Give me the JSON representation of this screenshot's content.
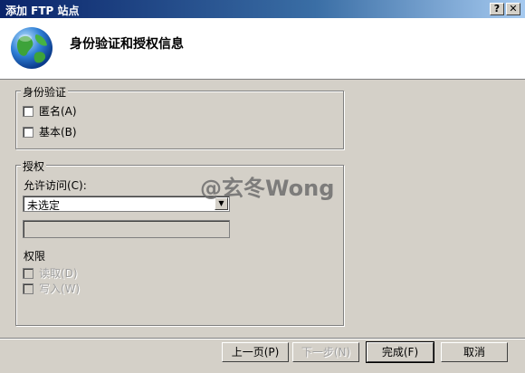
{
  "window": {
    "title": "添加 FTP 站点",
    "help_label": "?",
    "close_label": "✕"
  },
  "header": {
    "title": "身份验证和授权信息",
    "icon": "globe-icon"
  },
  "authentication": {
    "legend": "身份验证",
    "anonymous_label": "匿名(A)",
    "anonymous_checked": false,
    "basic_label": "基本(B)",
    "basic_checked": false
  },
  "authorization": {
    "legend": "授权",
    "allow_access_label": "允许访问(C):",
    "allow_access_value": "未选定",
    "user_field_value": "",
    "permissions_label": "权限",
    "read_label": "读取(D)",
    "read_checked": false,
    "write_label": "写入(W)",
    "write_checked": false
  },
  "watermark": "@玄冬Wong",
  "buttons": {
    "previous": "上一页(P)",
    "next": "下一步(N)",
    "finish": "完成(F)",
    "cancel": "取消"
  }
}
